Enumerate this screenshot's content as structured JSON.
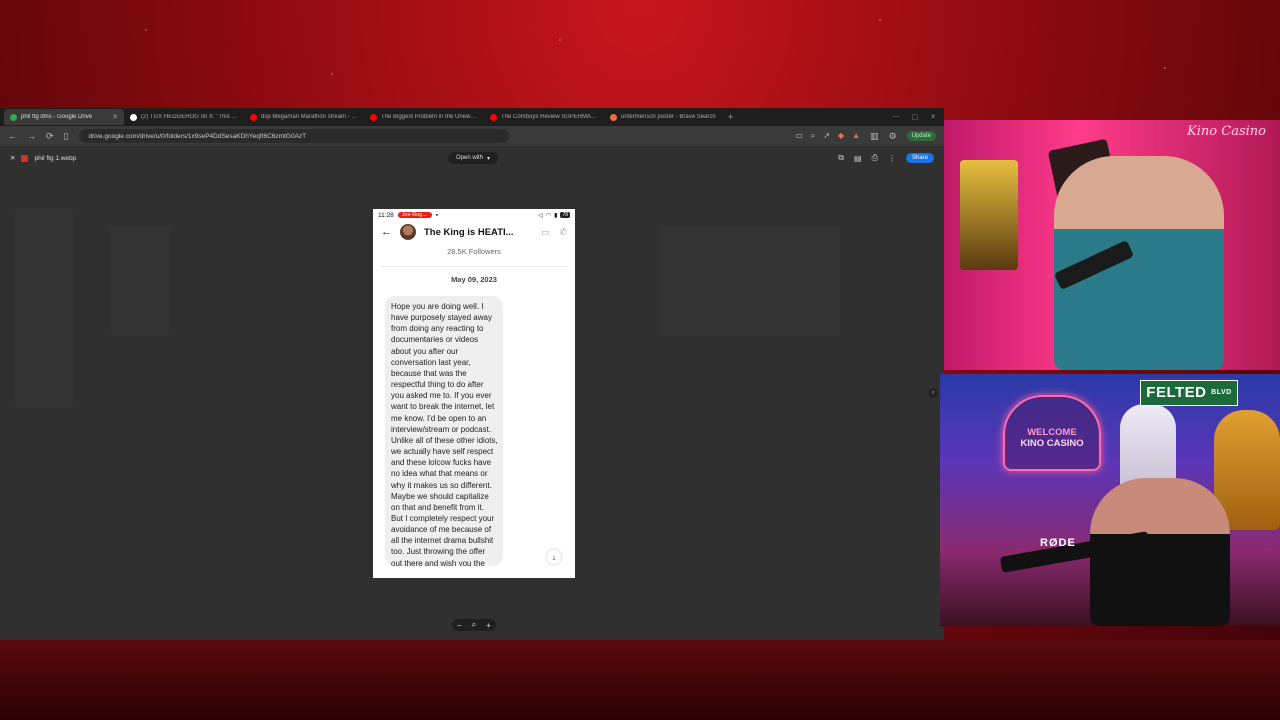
{
  "browser": {
    "tabs": [
      {
        "title": "phil ftg dms - Google Drive",
        "active": true,
        "color": "#34a853"
      },
      {
        "title": "(2) TGX HEDGEHOG on X: \"This is a…",
        "active": false,
        "color": "#ffffff"
      },
      {
        "title": "dsp Megaman Marathon stream - Y…",
        "active": false,
        "color": "#ff0000"
      },
      {
        "title": "The Biggest Problem in the Universe",
        "active": false,
        "color": "#ff0000"
      },
      {
        "title": "The Comboys Review SUPERMAN (I…",
        "active": false,
        "color": "#ff0000"
      },
      {
        "title": "untermensch poster - Brave Search",
        "active": false,
        "color": "#ff6a3d"
      }
    ],
    "url": "drive.google.com/drive/u/0/folders/1x9seP4DdSesaKDhYeqft6C6zmtG0AzT",
    "update_label": "Update"
  },
  "viewer": {
    "file_name": "phil ftg 1.webp",
    "open_with_label": "Open with",
    "share_label": "Share"
  },
  "phone": {
    "time": "11:28",
    "live_badge": "Joe Rog…",
    "battery": "78",
    "chat_name": "The King is HEATI...",
    "followers": "28.5K Followers",
    "date": "May 09, 2023",
    "message": "Hope you are doing well. I have purposely stayed away from doing any reacting to documentaries or videos about you after our conversation last year, because that was the respectful thing to do after you asked me to. If you ever want to break the internet, let me know. I'd be open to an interview/stream or podcast. Unlike all of these other idiots, we actually have self respect and these lolcow fucks have no idea what that means or why it makes us so different. Maybe we should capitalize on that and benefit from it. But I completely respect your avoidance of me because of all the internet drama bullshit too. Just throwing the offer out there and wish you the best."
  },
  "overlay": {
    "cam1_logo": "Kino Casino",
    "sign_welcome": "WELCOME",
    "sign_name": "KINO CASINO",
    "street_sign": "FELTED",
    "street_suffix": "BLVD",
    "mic_brand": "RØDE"
  }
}
